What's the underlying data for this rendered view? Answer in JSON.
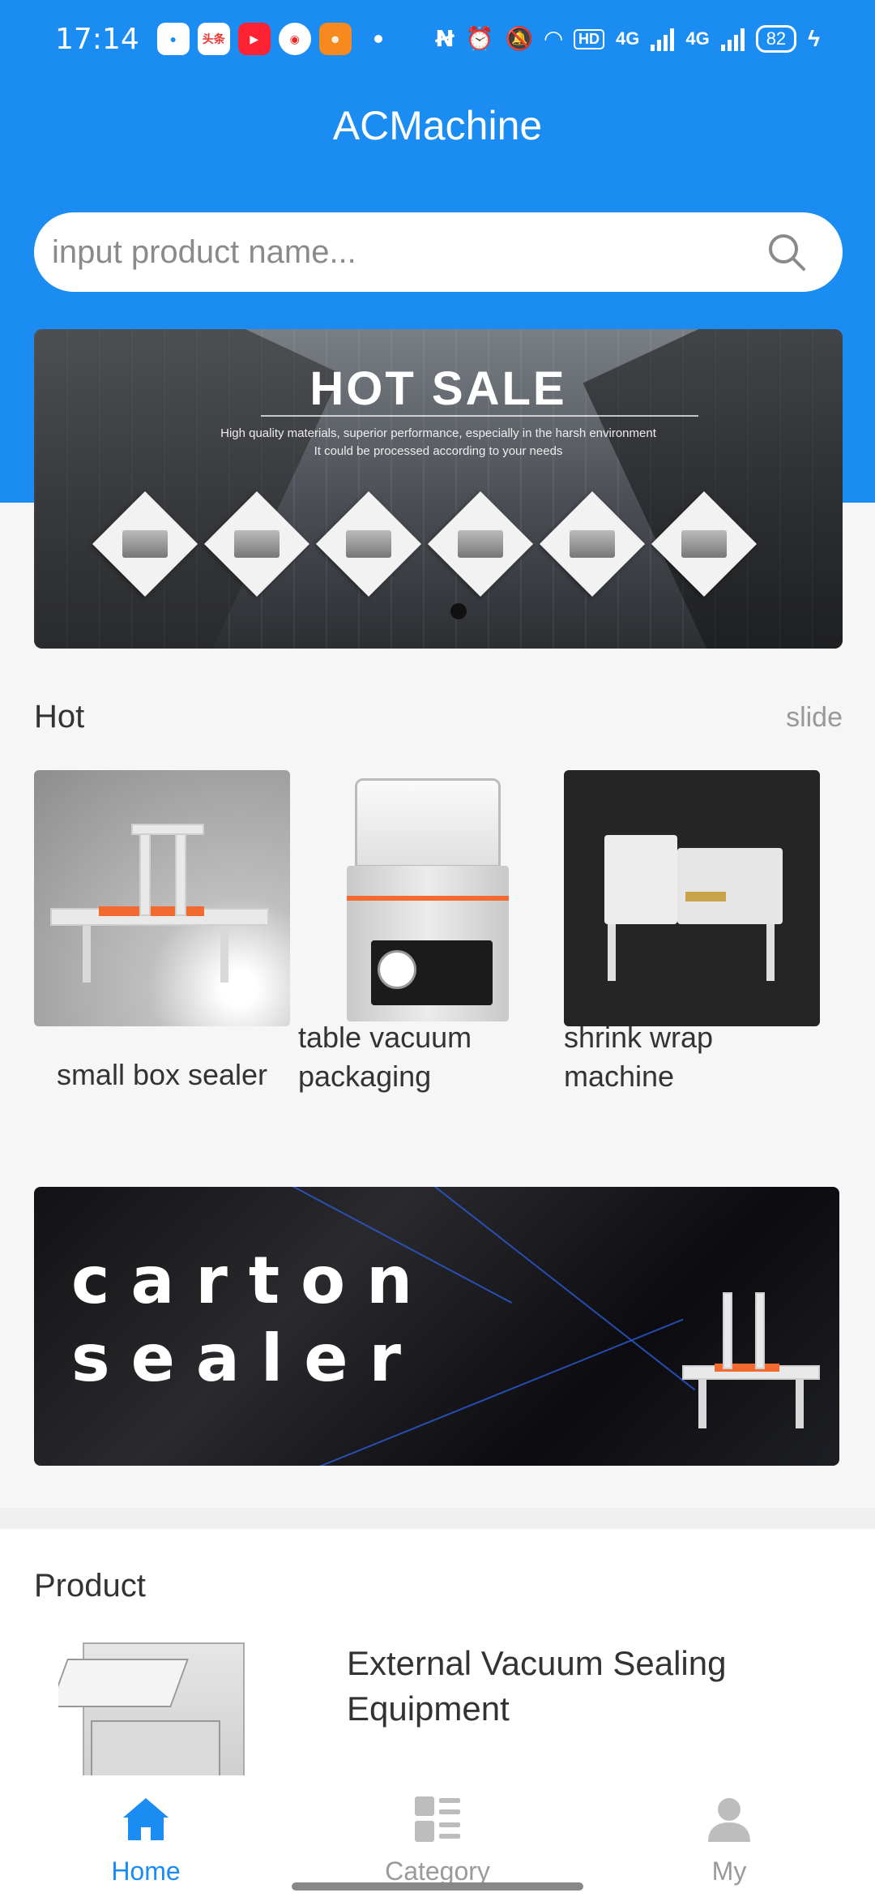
{
  "status_bar": {
    "time": "17:14",
    "notifications": [
      "头条",
      "▶"
    ],
    "network_1": "4G",
    "network_2": "4G",
    "hd": "HD",
    "battery": "82"
  },
  "header": {
    "title": "ACMachine"
  },
  "search": {
    "placeholder": "input product name...",
    "value": ""
  },
  "banner": {
    "title": "HOT SALE",
    "subtitle_line1": "High quality materials, superior performance, especially in the harsh environment",
    "subtitle_line2": "It could be processed according to your needs"
  },
  "hot": {
    "title": "Hot",
    "more_label": "slide",
    "items": [
      {
        "label": "small box sealer"
      },
      {
        "label": "table vacuum packaging"
      },
      {
        "label": "shrink wrap machine"
      }
    ]
  },
  "promo": {
    "line1": "carton",
    "line2": "sealer"
  },
  "product": {
    "title": "Product",
    "items": [
      {
        "name": "External Vacuum Sealing Equipment"
      }
    ]
  },
  "bottom_nav": {
    "items": [
      {
        "label": "Home",
        "active": true
      },
      {
        "label": "Category",
        "active": false
      },
      {
        "label": "My",
        "active": false
      }
    ]
  },
  "colors": {
    "primary": "#1a8cf2",
    "inactive": "#9a9a9a"
  }
}
